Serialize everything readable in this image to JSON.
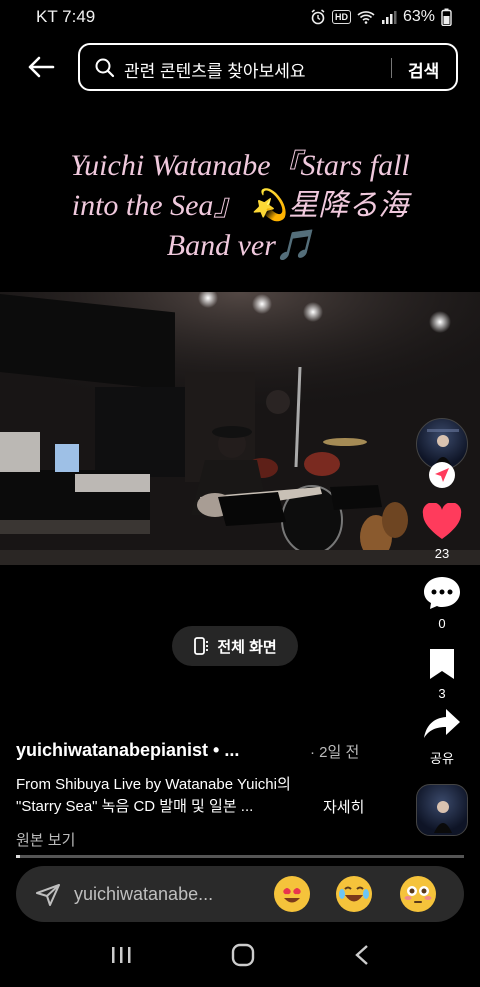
{
  "status_bar": {
    "carrier_time": "KT 7:49",
    "hd_label": "HD",
    "battery": "63%"
  },
  "header": {
    "search_placeholder": "관련 콘텐츠를 찾아보세요",
    "search_button": "검색"
  },
  "post_title": {
    "line1": "Yuichi Watanabe『Stars fall",
    "line2": "into the Sea』 💫星降る海",
    "line3": "Band ver🎵"
  },
  "fullscreen": {
    "label": "전체 화면"
  },
  "actions": {
    "likes": "23",
    "comments": "0",
    "saves": "3",
    "share_label": "공유"
  },
  "caption": {
    "username": "yuichiwatanabepianist • ...",
    "date": "· 2일 전",
    "line1": "From Shibuya Live by Watanabe Yuichi의",
    "line2": "\"Starry Sea\" 녹음 CD 발매 및 일본 ...",
    "more": "자세히",
    "original": "원본 보기"
  },
  "progress": 0.01,
  "message_bar": {
    "placeholder": "yuichiwatanabe..."
  },
  "colors": {
    "title": "#f0c9dd",
    "like_heart": "#ff3b5c",
    "send_badge": "#ff3b5c"
  }
}
